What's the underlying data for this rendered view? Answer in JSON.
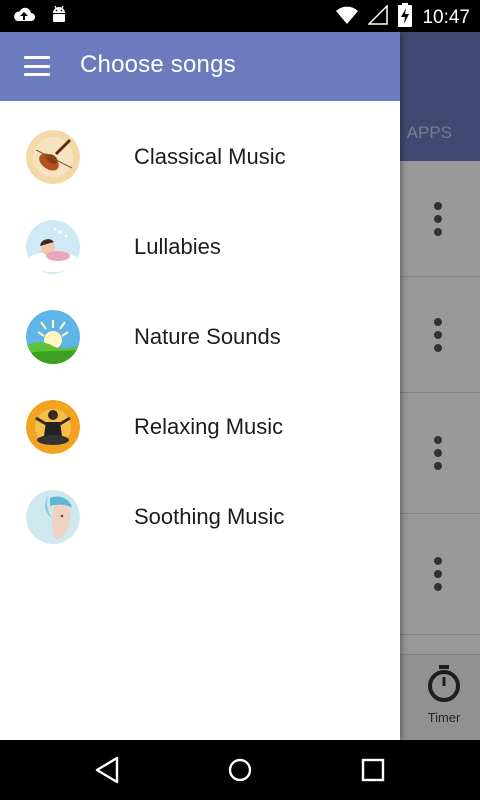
{
  "status_bar": {
    "time": "10:47",
    "icons": [
      "cloud-upload-icon",
      "android-icon",
      "wifi-icon",
      "signal-icon",
      "battery-charging-icon"
    ]
  },
  "background_app": {
    "tab_label": "APPS",
    "timer_label": "Timer",
    "toolbar_color": "#6b7bbd"
  },
  "drawer": {
    "title": "Choose songs",
    "header_color": "#6b7bbd",
    "items": [
      {
        "label": "Classical Music",
        "icon": "violin-icon"
      },
      {
        "label": "Lullabies",
        "icon": "sleeping-baby-icon"
      },
      {
        "label": "Nature Sounds",
        "icon": "sunny-meadow-icon"
      },
      {
        "label": "Relaxing Music",
        "icon": "meditation-icon"
      },
      {
        "label": "Soothing Music",
        "icon": "relaxing-woman-icon"
      }
    ]
  },
  "nav_bar": {
    "buttons": [
      "back-icon",
      "home-icon",
      "recents-icon"
    ]
  }
}
